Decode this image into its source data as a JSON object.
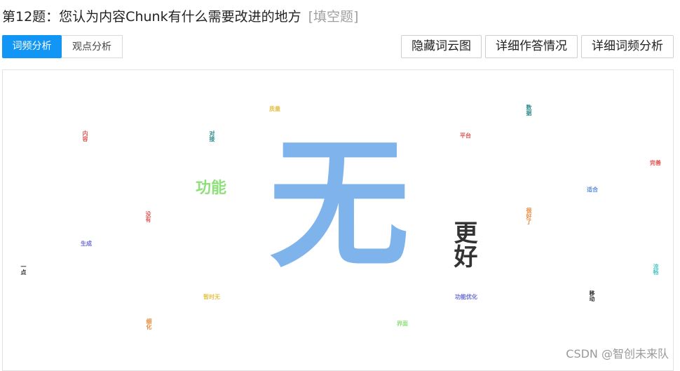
{
  "question": {
    "title": "第12题：您认为内容Chunk有什么需要改进的地方",
    "type": "[填空题]"
  },
  "tabs": [
    {
      "label": "词频分析",
      "active": true
    },
    {
      "label": "观点分析",
      "active": false
    }
  ],
  "actions": {
    "hide_cloud": "隐藏词云图",
    "detail_answers": "详细作答情况",
    "detail_freq": "详细词频分析"
  },
  "word_cloud": {
    "words": [
      {
        "text": "无",
        "color": "#7fb3eb"
      },
      {
        "text": "更好",
        "color": "#333333"
      },
      {
        "text": "功能",
        "color": "#8ee07a"
      },
      {
        "text": "质量",
        "color": "#e8c34a"
      },
      {
        "text": "内容",
        "color": "#e0605c"
      },
      {
        "text": "对接",
        "color": "#2e8b8b"
      },
      {
        "text": "平台",
        "color": "#e05252"
      },
      {
        "text": "完善",
        "color": "#e05252"
      },
      {
        "text": "适合",
        "color": "#5b8fe0"
      },
      {
        "text": "没有",
        "color": "#e0605c"
      },
      {
        "text": "生成",
        "color": "#6e6ed8"
      },
      {
        "text": "一点",
        "color": "#333333"
      },
      {
        "text": "暂时无",
        "color": "#e8c34a"
      },
      {
        "text": "功能优化",
        "color": "#6e6ed8"
      },
      {
        "text": "界面",
        "color": "#8ee07a"
      },
      {
        "text": "细化",
        "color": "#e8893a"
      },
      {
        "text": "很好了",
        "color": "#e8893a"
      },
      {
        "text": "流畅",
        "color": "#5bc8c8"
      },
      {
        "text": "移动",
        "color": "#333333"
      },
      {
        "text": "数据",
        "color": "#2e8b8b"
      }
    ]
  },
  "watermark": "CSDN @智创未来队"
}
